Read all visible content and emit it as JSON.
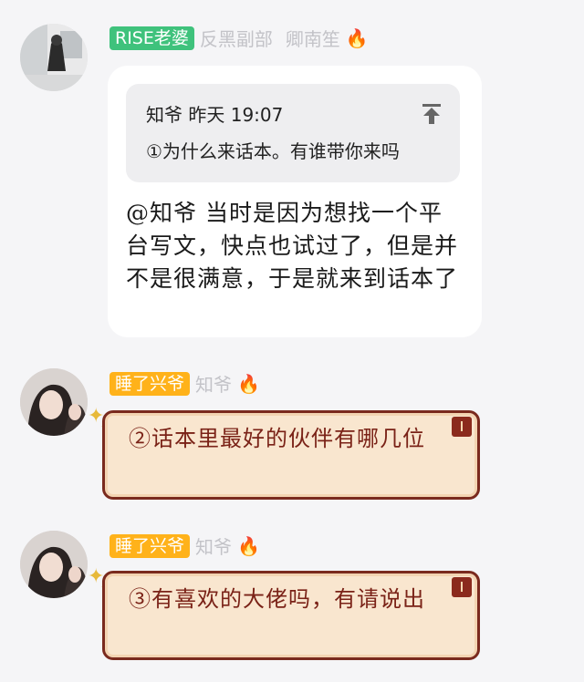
{
  "messages": [
    {
      "badge": "RISE老婆",
      "tags": "反黑副部",
      "name": "卿南笙",
      "quote": {
        "author_time": "知爷 昨天 19:07",
        "text": "①为什么来话本。有谁带你来吗"
      },
      "text": "@知爷 当时是因为想找一个平台写文，快点也试过了，但是并不是很满意，于是就来到话本了"
    },
    {
      "badge": "睡了兴爷",
      "name": "知爷",
      "text": "②话本里最好的伙伴有哪几位"
    },
    {
      "badge": "睡了兴爷",
      "name": "知爷",
      "text": "③有喜欢的大佬吗，有请说出"
    }
  ],
  "icons": [
    "fire-icon",
    "pin-to-top-icon",
    "bookmark-icon",
    "sparkle-icon"
  ],
  "colors": {
    "badge_green": "#3fc27c",
    "badge_orange": "#ffb21a",
    "frame_border": "#7a2a1e",
    "frame_fill": "#f9e6cf",
    "frame_text": "#7a2217"
  }
}
